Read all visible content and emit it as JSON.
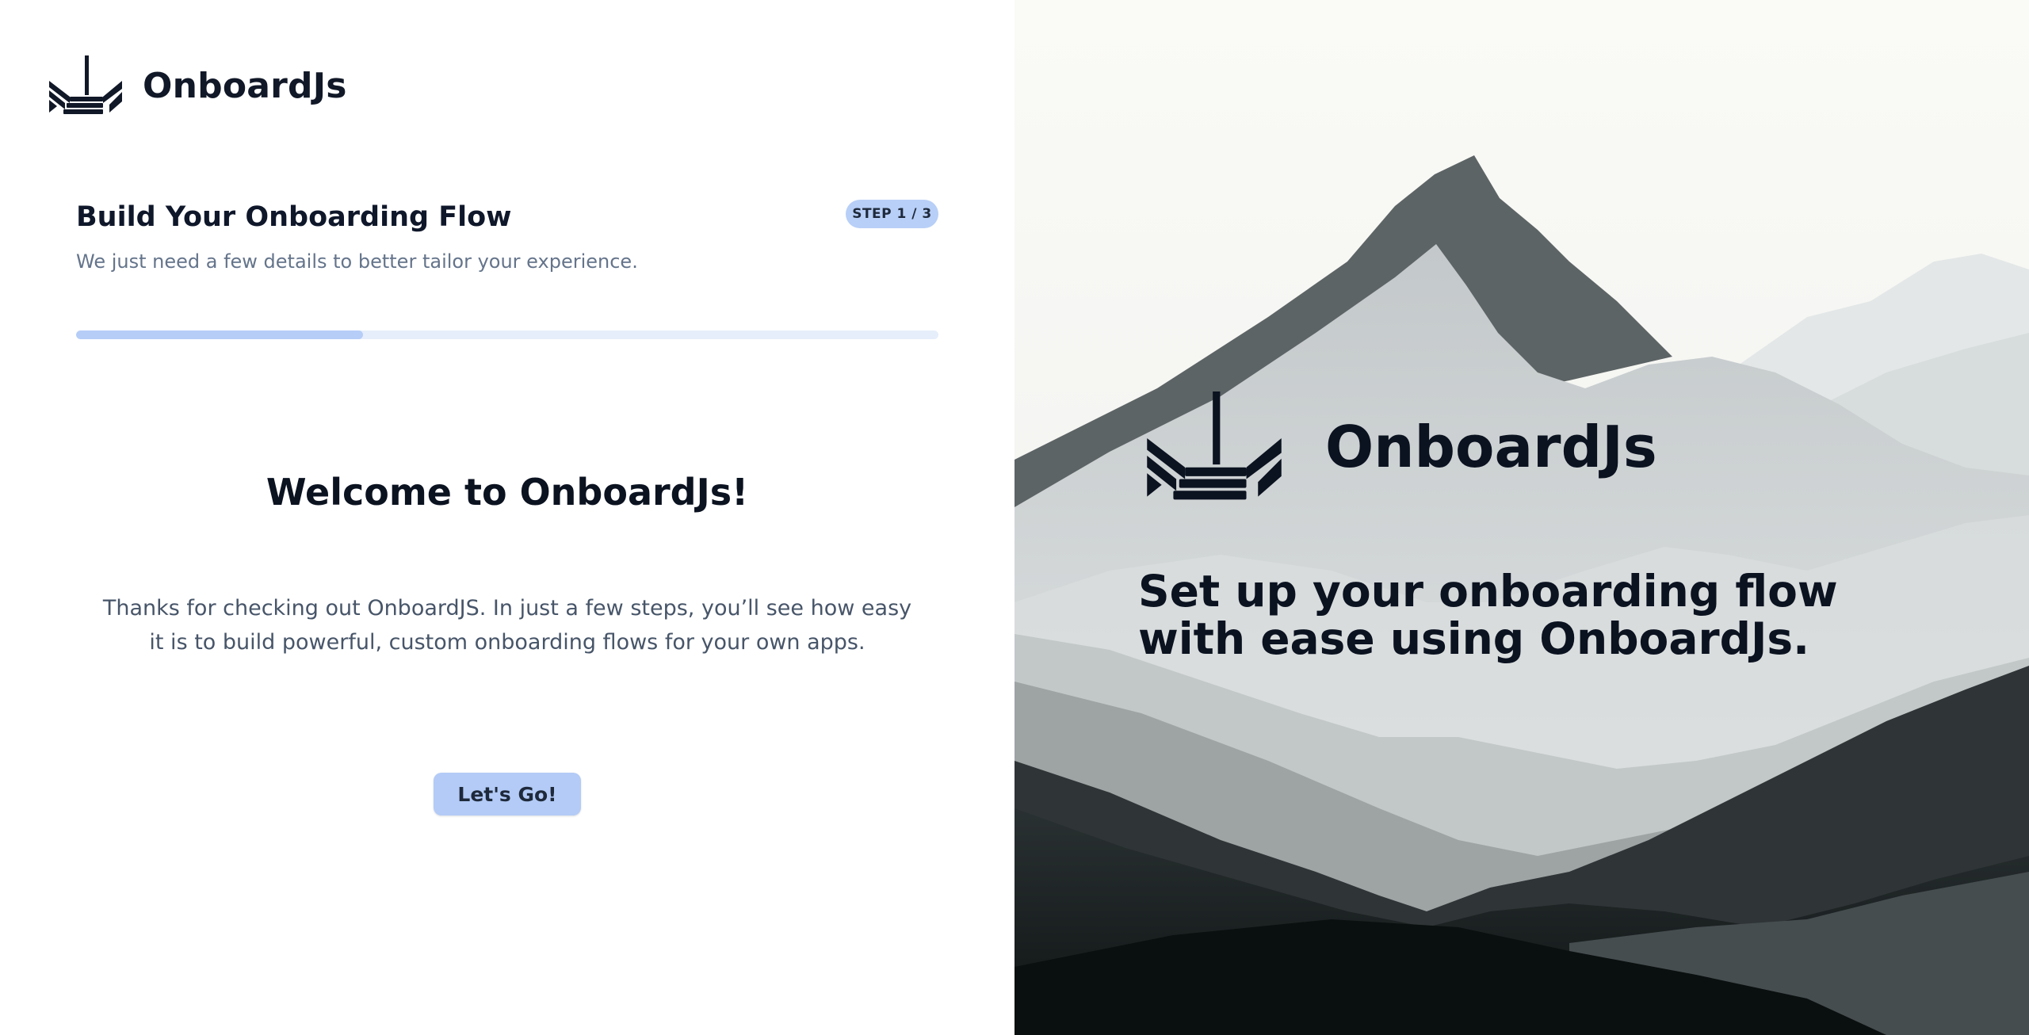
{
  "brand": {
    "name": "OnboardJs",
    "logo_icon": "onboardjs-logo-icon"
  },
  "flow": {
    "title": "Build Your Onboarding Flow",
    "subtitle": "We just need a few details to better tailor your experience.",
    "step_badge": "STEP 1 / 3",
    "progress_fraction": 0.333
  },
  "welcome": {
    "title": "Welcome to OnboardJs!",
    "text": "Thanks for checking out OnboardJS. In just a few steps, you’ll see how easy it is to build powerful, custom onboarding flows for your own apps.",
    "cta_label": "Let's Go!"
  },
  "hero": {
    "name": "OnboardJs",
    "tagline": "Set up your onboarding flow with ease using OnboardJs.",
    "background_icon": "mountain-landscape-illustration"
  },
  "colors": {
    "accent": "#b3cbf6",
    "progress_track": "#e6eefb",
    "text_dark": "#0f172a",
    "text_muted": "#64748b"
  }
}
